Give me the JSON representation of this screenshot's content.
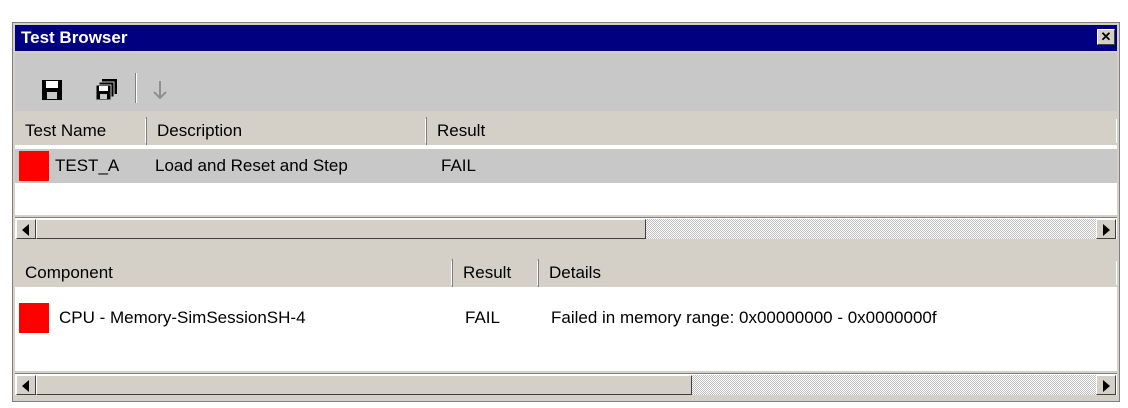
{
  "window": {
    "title": "Test Browser"
  },
  "toolbar": {
    "buttons": [
      {
        "icon": "floppy-disk-save-icon"
      },
      {
        "icon": "save-all-icon"
      },
      {
        "icon": "arrow-down-icon"
      }
    ]
  },
  "tests_table": {
    "columns": [
      "Test Name",
      "Description",
      "Result"
    ],
    "rows": [
      {
        "status_color": "#ff0000",
        "name": "TEST_A",
        "description": "Load and Reset and Step",
        "result": "FAIL"
      }
    ]
  },
  "components_table": {
    "columns": [
      "Component",
      "Result",
      "Details"
    ],
    "rows": [
      {
        "status_color": "#ff0000",
        "component": "CPU - Memory-SimSessionSH-4",
        "result": "FAIL",
        "details": "Failed in memory range: 0x00000000 - 0x0000000f"
      }
    ]
  },
  "colors": {
    "titlebar": "#000080",
    "fail": "#ff0000",
    "selected_row": "#c8c8c8"
  }
}
